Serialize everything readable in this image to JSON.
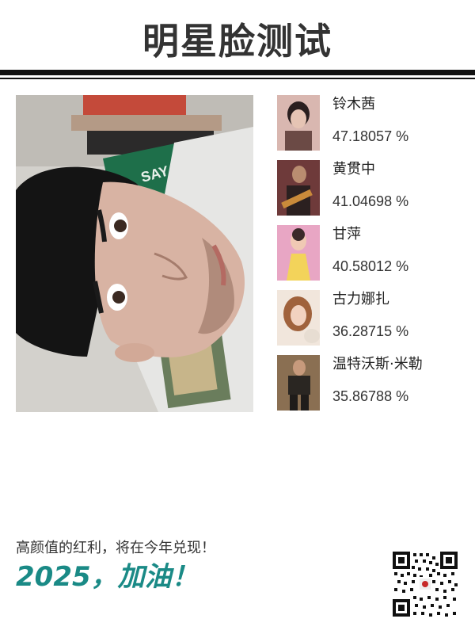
{
  "header": {
    "title": "明星脸测试"
  },
  "results": [
    {
      "name": "铃木茜",
      "score": "47.18057 %",
      "thumb_bg": "#d9b7b0",
      "thumb_fg": "#6b4a45"
    },
    {
      "name": "黄贯中",
      "score": "41.04698 %",
      "thumb_bg": "#6e3a3a",
      "thumb_fg": "#2b2020"
    },
    {
      "name": "甘萍",
      "score": "40.58012 %",
      "thumb_bg": "#e8a6c4",
      "thumb_fg": "#f3d35a"
    },
    {
      "name": "古力娜扎",
      "score": "36.28715 %",
      "thumb_bg": "#f1e6dc",
      "thumb_fg": "#a0623c"
    },
    {
      "name": "温特沃斯·米勒",
      "score": "35.86788 %",
      "thumb_bg": "#8a6f52",
      "thumb_fg": "#2a2622"
    }
  ],
  "footer": {
    "slogan": "高颜值的红利，将在今年兑现！",
    "cheer": "2025，加油！"
  },
  "colors": {
    "accent": "#1a8a86",
    "rule": "#111111",
    "title": "#333333"
  },
  "icons": {
    "qr": "qr-code-icon"
  }
}
